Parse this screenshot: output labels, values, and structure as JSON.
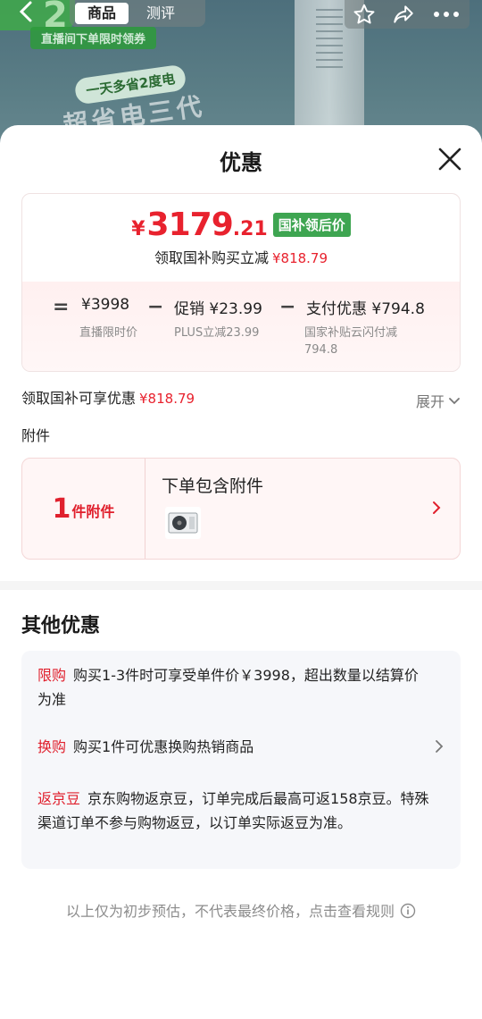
{
  "background": {
    "tabs": [
      "商品",
      "测评"
    ],
    "promo_strip": "直播间下单限时领券",
    "bubble": "一天多省2度电",
    "slogan": "超省电三代"
  },
  "sheet": {
    "title": "优惠"
  },
  "price_card": {
    "currency": "¥",
    "price_integer": "3179",
    "price_decimal": ".21",
    "badge": "国补领后价",
    "subsidy_label": "领取国补购买立减",
    "subsidy_amount": "¥818.79",
    "breakdown": {
      "equals": "=",
      "minus": "−",
      "live_price": "¥3998",
      "live_price_label": "直播限时价",
      "promo_label": "促销 ¥23.99",
      "promo_sub": "PLUS立减23.99",
      "pay_label": "支付优惠 ¥794.8",
      "pay_sub": "国家补贴云闪付减794.8"
    }
  },
  "claim": {
    "label": "领取国补可享优惠",
    "amount": "¥818.79",
    "expand": "展开"
  },
  "accessories": {
    "title": "附件",
    "count": "1",
    "count_unit": "件附件",
    "description": "下单包含附件"
  },
  "other_offers": {
    "title": "其他优惠",
    "items": [
      {
        "tag": "限购",
        "text": "购买1-3件时可享受单件价￥3998，超出数量以结算价为准"
      },
      {
        "tag": "换购",
        "text": "购买1件可优惠换购热销商品"
      },
      {
        "tag": "返京豆",
        "text": "京东购物返京豆，订单完成后最高可返158京豆。特殊渠道订单不参与购物返豆，以订单实际返豆为准。"
      }
    ]
  },
  "footer": {
    "note": "以上仅为初步预估，不代表最终价格，点击查看规则"
  },
  "colors": {
    "accent_red": "#e8222e",
    "badge_green": "#3ea551"
  }
}
